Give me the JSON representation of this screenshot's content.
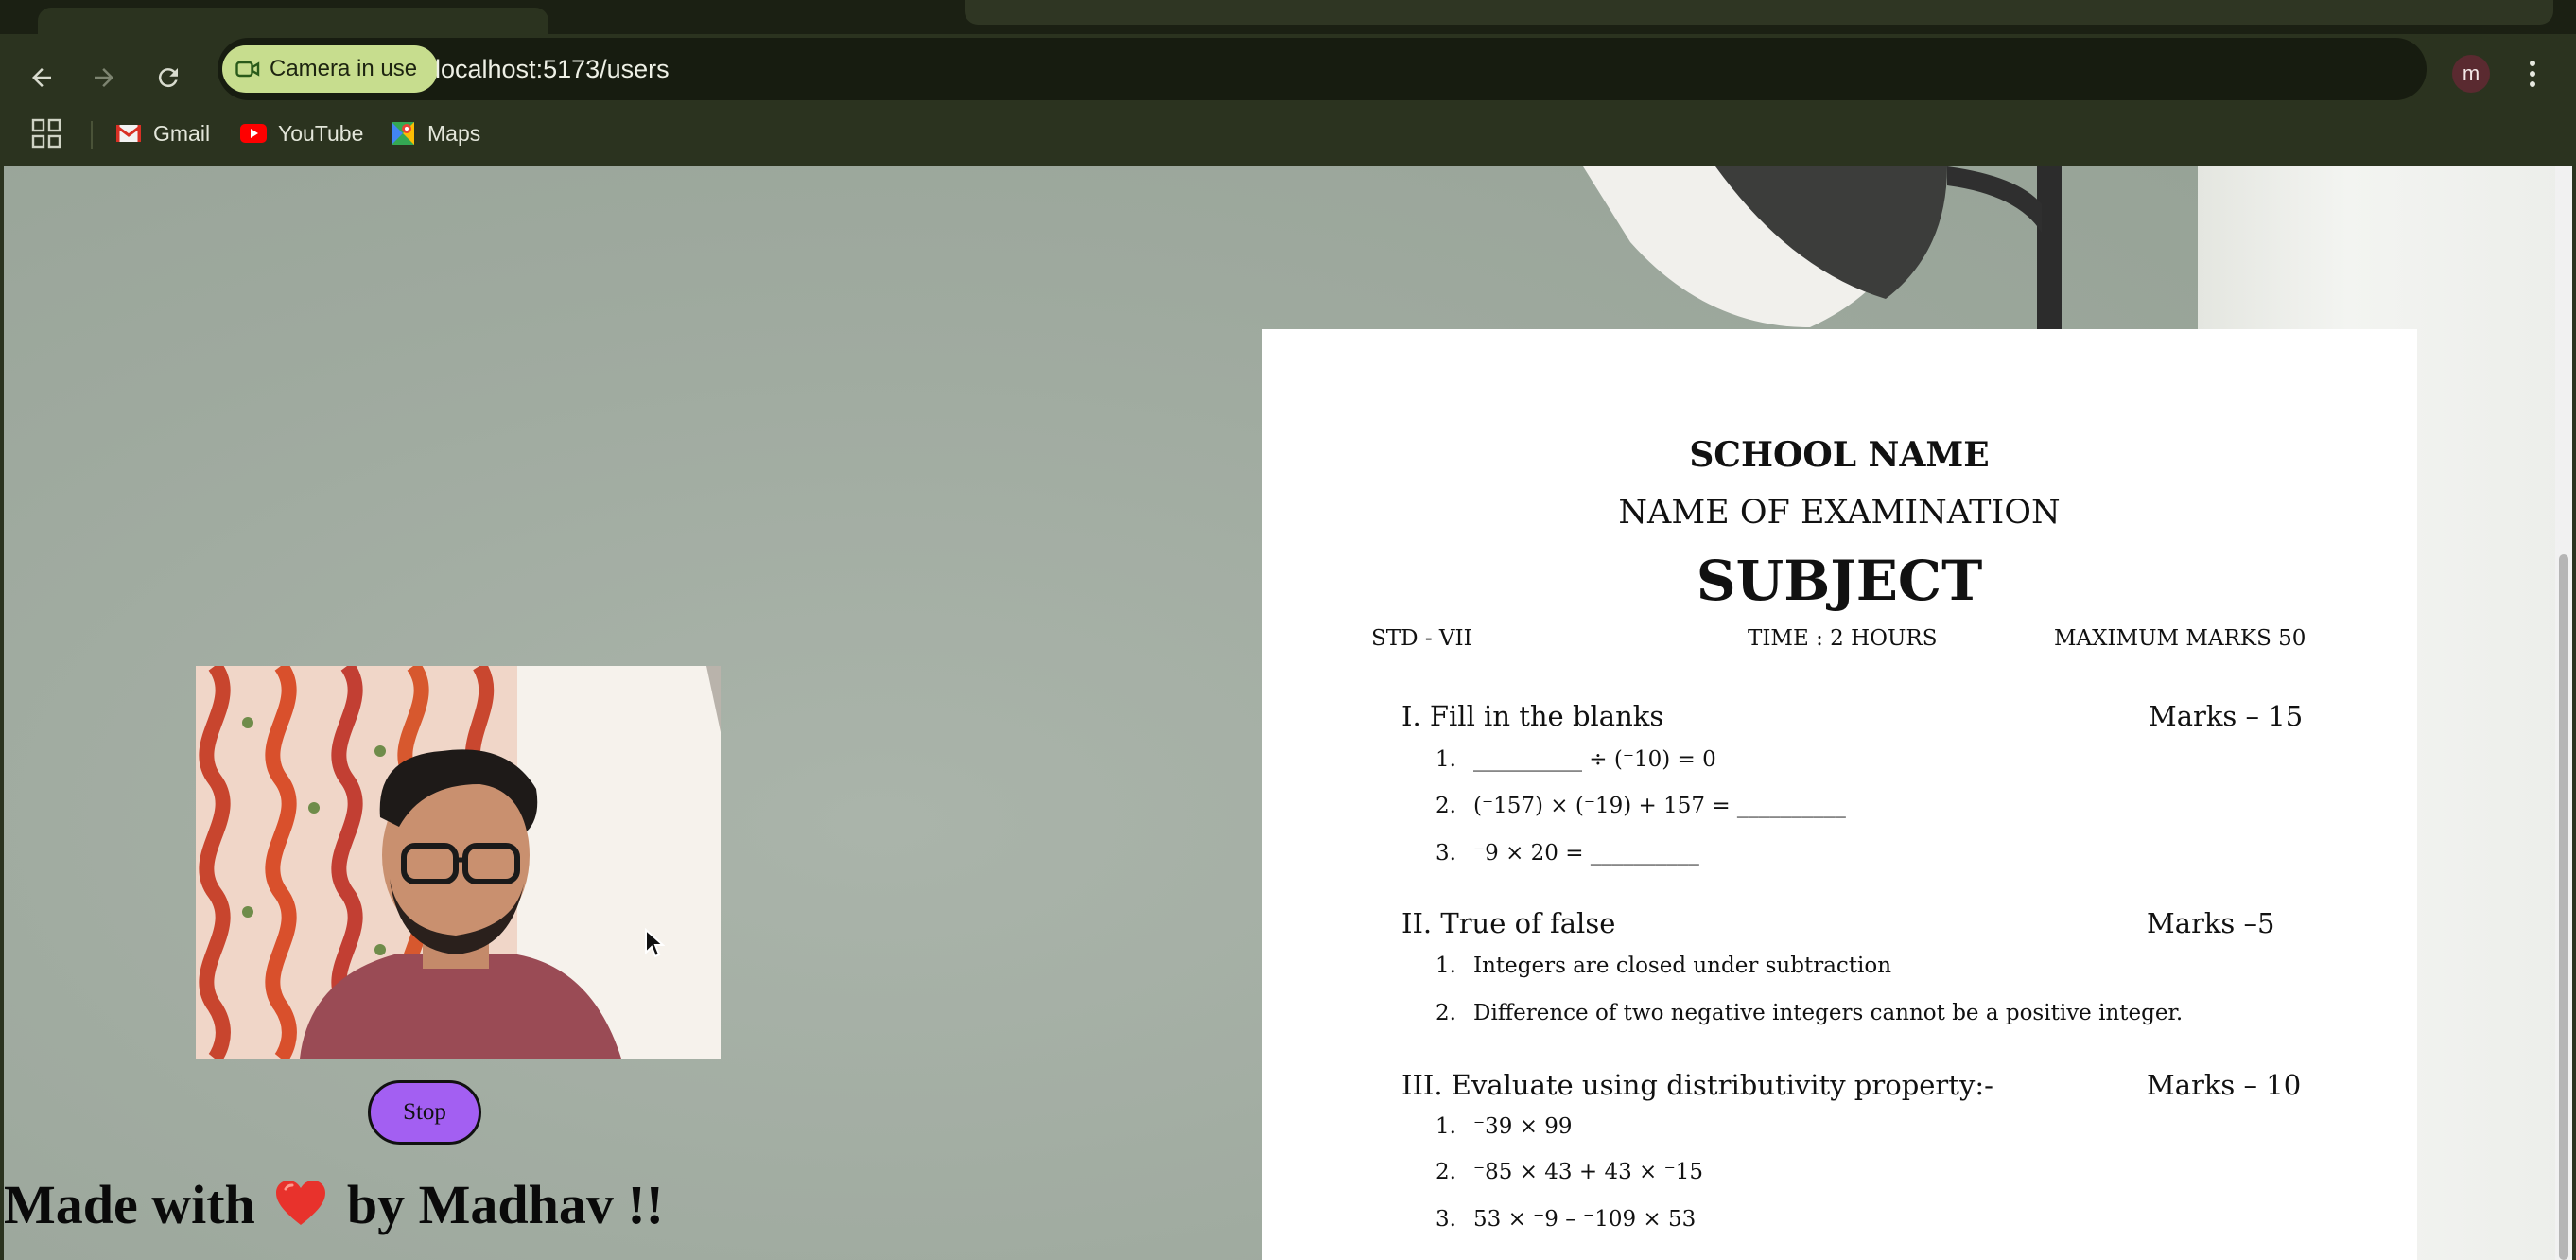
{
  "browser": {
    "camera_chip": "Camera in use",
    "url": "localhost:5173/users",
    "avatar_initial": "m",
    "bookmarks": [
      {
        "label": "Gmail",
        "icon": "gmail-icon"
      },
      {
        "label": "YouTube",
        "icon": "youtube-icon"
      },
      {
        "label": "Maps",
        "icon": "maps-icon"
      }
    ]
  },
  "page": {
    "stop_button": "Stop",
    "footer_before": "Made with",
    "footer_after": "by Madhav !!",
    "footer_icon": "heart-icon"
  },
  "paper": {
    "school_name": "SCHOOL NAME",
    "exam_name": "NAME OF EXAMINATION",
    "subject": "SUBJECT",
    "std": "STD - VII",
    "time": "TIME : 2 HOURS",
    "max_marks": "MAXIMUM MARKS 50",
    "sections": [
      {
        "title": "I. Fill in the blanks",
        "marks": "Marks – 15",
        "questions": [
          {
            "num": "1.",
            "text": "__________ ÷ (⁻10) = 0"
          },
          {
            "num": "2.",
            "text": "(⁻157) × (⁻19) + 157 = __________"
          },
          {
            "num": "3.",
            "text": "⁻9 × 20 = __________"
          }
        ]
      },
      {
        "title": "II. True of false",
        "marks": "Marks –5",
        "questions": [
          {
            "num": "1.",
            "text": "Integers are closed under subtraction"
          },
          {
            "num": "2.",
            "text": "Difference of two negative integers cannot be a positive integer."
          }
        ]
      },
      {
        "title": "III. Evaluate using distributivity property:-",
        "marks": "Marks – 10",
        "questions": [
          {
            "num": "1.",
            "text": "⁻39 × 99"
          },
          {
            "num": "2.",
            "text": "⁻85 × 43 + 43 × ⁻15"
          },
          {
            "num": "3.",
            "text": "53 × ⁻9 – ⁻109 × 53"
          }
        ]
      }
    ]
  },
  "colors": {
    "chrome_bg": "#2b331f",
    "camera_chip_bg": "#c7dd8e",
    "stop_button_bg": "#a35ff2",
    "heart": "#e8322c"
  }
}
